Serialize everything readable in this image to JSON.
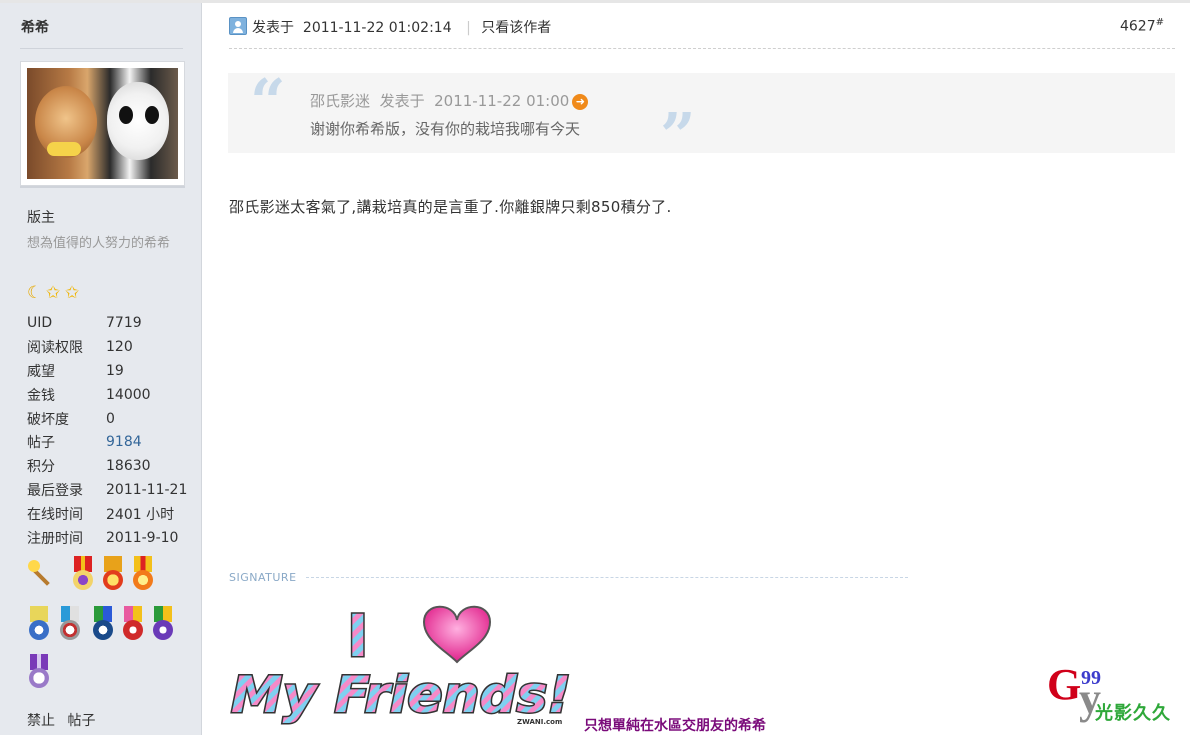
{
  "author": {
    "name": "希希",
    "rank": "版主",
    "motto": "想為值得的人努力的希希",
    "level_icons": [
      "moon-icon",
      "star-icon",
      "star-icon"
    ],
    "stats": [
      {
        "key": "UID",
        "value": "7719",
        "link": false
      },
      {
        "key": "阅读权限",
        "value": "120",
        "link": false
      },
      {
        "key": "威望",
        "value": "19",
        "link": false
      },
      {
        "key": "金钱",
        "value": "14000",
        "link": false
      },
      {
        "key": "破坏度",
        "value": "0",
        "link": false
      },
      {
        "key": "帖子",
        "value": "9184",
        "link": true
      },
      {
        "key": "积分",
        "value": "18630",
        "link": false
      },
      {
        "key": "最后登录",
        "value": "2011-11-21",
        "link": false
      },
      {
        "key": "在线时间",
        "value": "2401 小时",
        "link": false
      },
      {
        "key": "注册时间",
        "value": "2011-9-10",
        "link": false
      }
    ],
    "medal_count": 10,
    "footer_links": [
      "禁止",
      "帖子"
    ]
  },
  "post": {
    "posted_label": "发表于",
    "posted_time": "2011-11-22 01:02:14",
    "only_author_label": "只看该作者",
    "floor": "4627",
    "floor_suffix": "#",
    "quote": {
      "author": "邵氏影迷",
      "posted_label": "发表于",
      "time": "2011-11-22 01:00",
      "text": "谢谢你希希版，没有你的栽培我哪有今天"
    },
    "message": "邵氏影迷太客氣了,講栽培真的是言重了.你離銀牌只剩850積分了."
  },
  "signature": {
    "label": "SIGNATURE",
    "image_text_line1": "I",
    "image_text_line2": "My Friends!",
    "image_credit": "ZWANI.com",
    "caption": "只想單純在水區交朋友的希希"
  },
  "watermark": {
    "letters_g": "G",
    "letters_y": "y",
    "number": "99",
    "text": "光影久久"
  },
  "colors": {
    "sidebar_bg": "#e6e9ee",
    "link": "#336699",
    "quote_bg": "#f5f5f5",
    "caption": "#7a0a7a",
    "watermark_red": "#d0001a",
    "watermark_green": "#2fa83a"
  }
}
